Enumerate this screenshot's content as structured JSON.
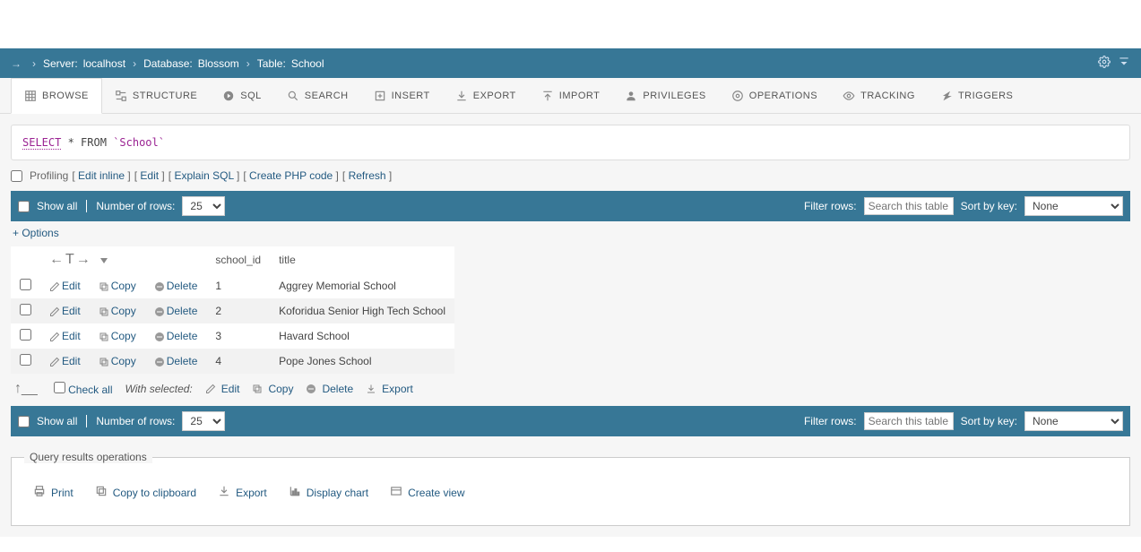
{
  "breadcrumb": {
    "server_label": "Server:",
    "server_value": "localhost",
    "db_label": "Database:",
    "db_value": "Blossom",
    "table_label": "Table:",
    "table_value": "School"
  },
  "tabs": [
    {
      "label": "Browse"
    },
    {
      "label": "Structure"
    },
    {
      "label": "SQL"
    },
    {
      "label": "Search"
    },
    {
      "label": "Insert"
    },
    {
      "label": "Export"
    },
    {
      "label": "Import"
    },
    {
      "label": "Privileges"
    },
    {
      "label": "Operations"
    },
    {
      "label": "Tracking"
    },
    {
      "label": "Triggers"
    }
  ],
  "sql": {
    "select": "SELECT",
    "star_from": "* FROM",
    "table": "`School`"
  },
  "sql_actions": {
    "profiling": "Profiling",
    "edit_inline": "Edit inline",
    "edit": "Edit",
    "explain": "Explain SQL",
    "create_php": "Create PHP code",
    "refresh": "Refresh"
  },
  "controls": {
    "show_all": "Show all",
    "num_rows_label": "Number of rows:",
    "num_rows_value": "25",
    "filter_label": "Filter rows:",
    "filter_placeholder": "Search this table",
    "sort_label": "Sort by key:",
    "sort_value": "None"
  },
  "options_link": "+ Options",
  "table": {
    "columns": [
      "school_id",
      "title"
    ],
    "row_actions": {
      "edit": "Edit",
      "copy": "Copy",
      "delete": "Delete"
    },
    "rows": [
      {
        "school_id": "1",
        "title": "Aggrey Memorial School"
      },
      {
        "school_id": "2",
        "title": "Koforidua Senior High Tech School"
      },
      {
        "school_id": "3",
        "title": "Havard School"
      },
      {
        "school_id": "4",
        "title": "Pope Jones School"
      }
    ]
  },
  "bulk": {
    "check_all": "Check all",
    "with_selected": "With selected:",
    "edit": "Edit",
    "copy": "Copy",
    "delete": "Delete",
    "export": "Export"
  },
  "results_ops": {
    "legend": "Query results operations",
    "print": "Print",
    "clipboard": "Copy to clipboard",
    "export": "Export",
    "chart": "Display chart",
    "create_view": "Create view"
  }
}
